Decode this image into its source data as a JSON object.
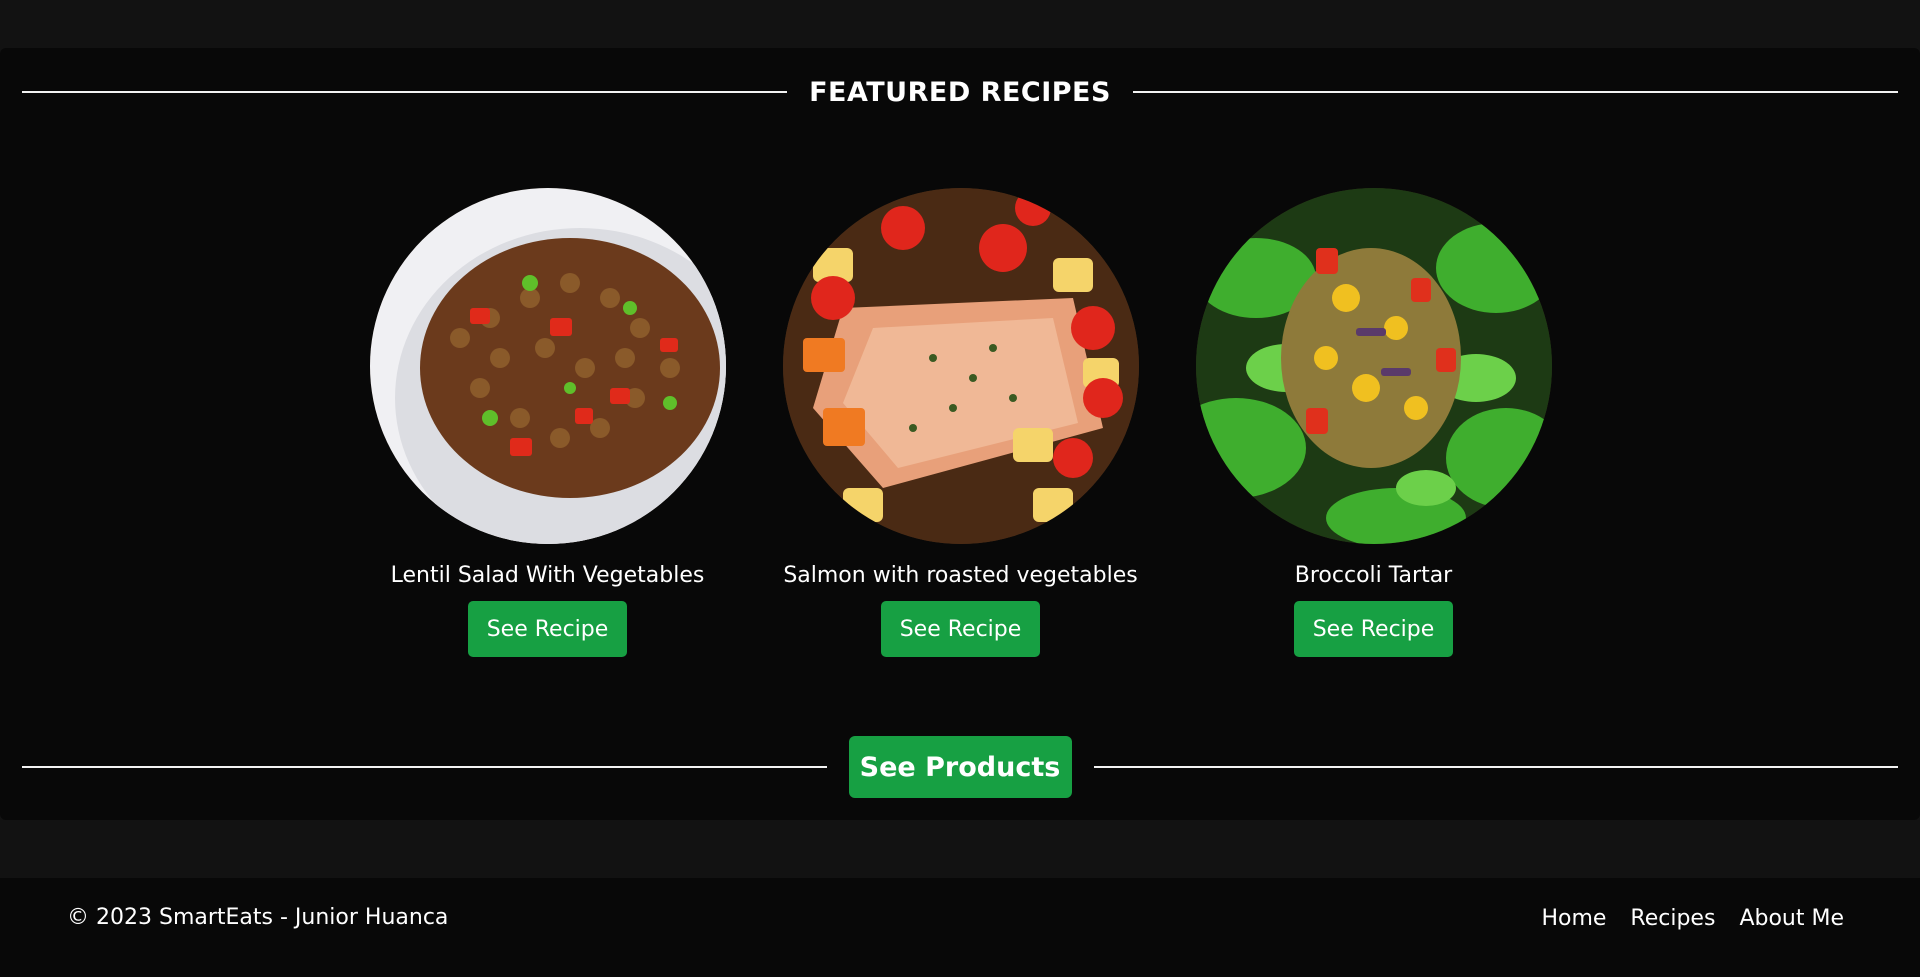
{
  "featured": {
    "heading": "FEATURED RECIPES"
  },
  "recipes": [
    {
      "title": "Lentil Salad With Vegetables",
      "button_label": "See Recipe",
      "image_description": "bowl of lentil salad with vegetables"
    },
    {
      "title": "Salmon with roasted vegetables",
      "button_label": "See Recipe",
      "image_description": "salmon fillet with roasted potatoes and tomatoes"
    },
    {
      "title": "Broccoli Tartar",
      "button_label": "See Recipe",
      "image_description": "broccoli tartar with greens"
    }
  ],
  "products": {
    "button_label": "See Products"
  },
  "footer": {
    "copyright": "© 2023 SmartEats - Junior Huanca",
    "nav": [
      "Home",
      "Recipes",
      "About Me"
    ]
  },
  "colors": {
    "background": "#121212",
    "panel": "#080808",
    "accent": "#17a043",
    "text": "#ffffff"
  }
}
